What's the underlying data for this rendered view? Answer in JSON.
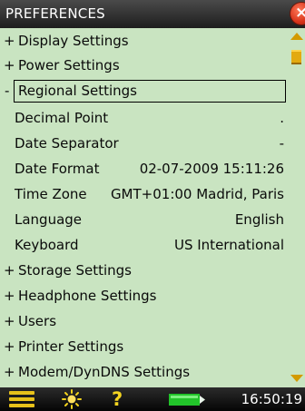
{
  "header": {
    "title": "PREFERENCES",
    "close_glyph": "×"
  },
  "menu": {
    "sections_top": [
      {
        "sign": "+",
        "label": "Display Settings"
      },
      {
        "sign": "+",
        "label": "Power Settings"
      },
      {
        "sign": "-",
        "label": "Regional Settings"
      }
    ],
    "regional_items": [
      {
        "label": "Decimal Point",
        "value": "."
      },
      {
        "label": "Date Separator",
        "value": "-"
      },
      {
        "label": "Date Format",
        "value": "02-07-2009 15:11:26"
      },
      {
        "label": "Time Zone",
        "value": "GMT+01:00 Madrid, Paris"
      },
      {
        "label": "Language",
        "value": "English"
      },
      {
        "label": "Keyboard",
        "value": "US International"
      }
    ],
    "sections_bottom": [
      {
        "sign": "+",
        "label": "Storage Settings"
      },
      {
        "sign": "+",
        "label": "Headphone Settings"
      },
      {
        "sign": "+",
        "label": "Users"
      },
      {
        "sign": "+",
        "label": "Printer Settings"
      },
      {
        "sign": "+",
        "label": "Modem/DynDNS Settings"
      }
    ]
  },
  "statusbar": {
    "help_glyph": "?",
    "time": "16:50:19"
  },
  "colors": {
    "list_background": "#c9e4c1",
    "accent": "#e7c11a",
    "close_button": "#d8341a"
  },
  "icons": [
    "menu-icon",
    "brightness-icon",
    "help-icon",
    "battery-icon",
    "close-icon",
    "scroll-up-icon",
    "scroll-down-icon"
  ]
}
